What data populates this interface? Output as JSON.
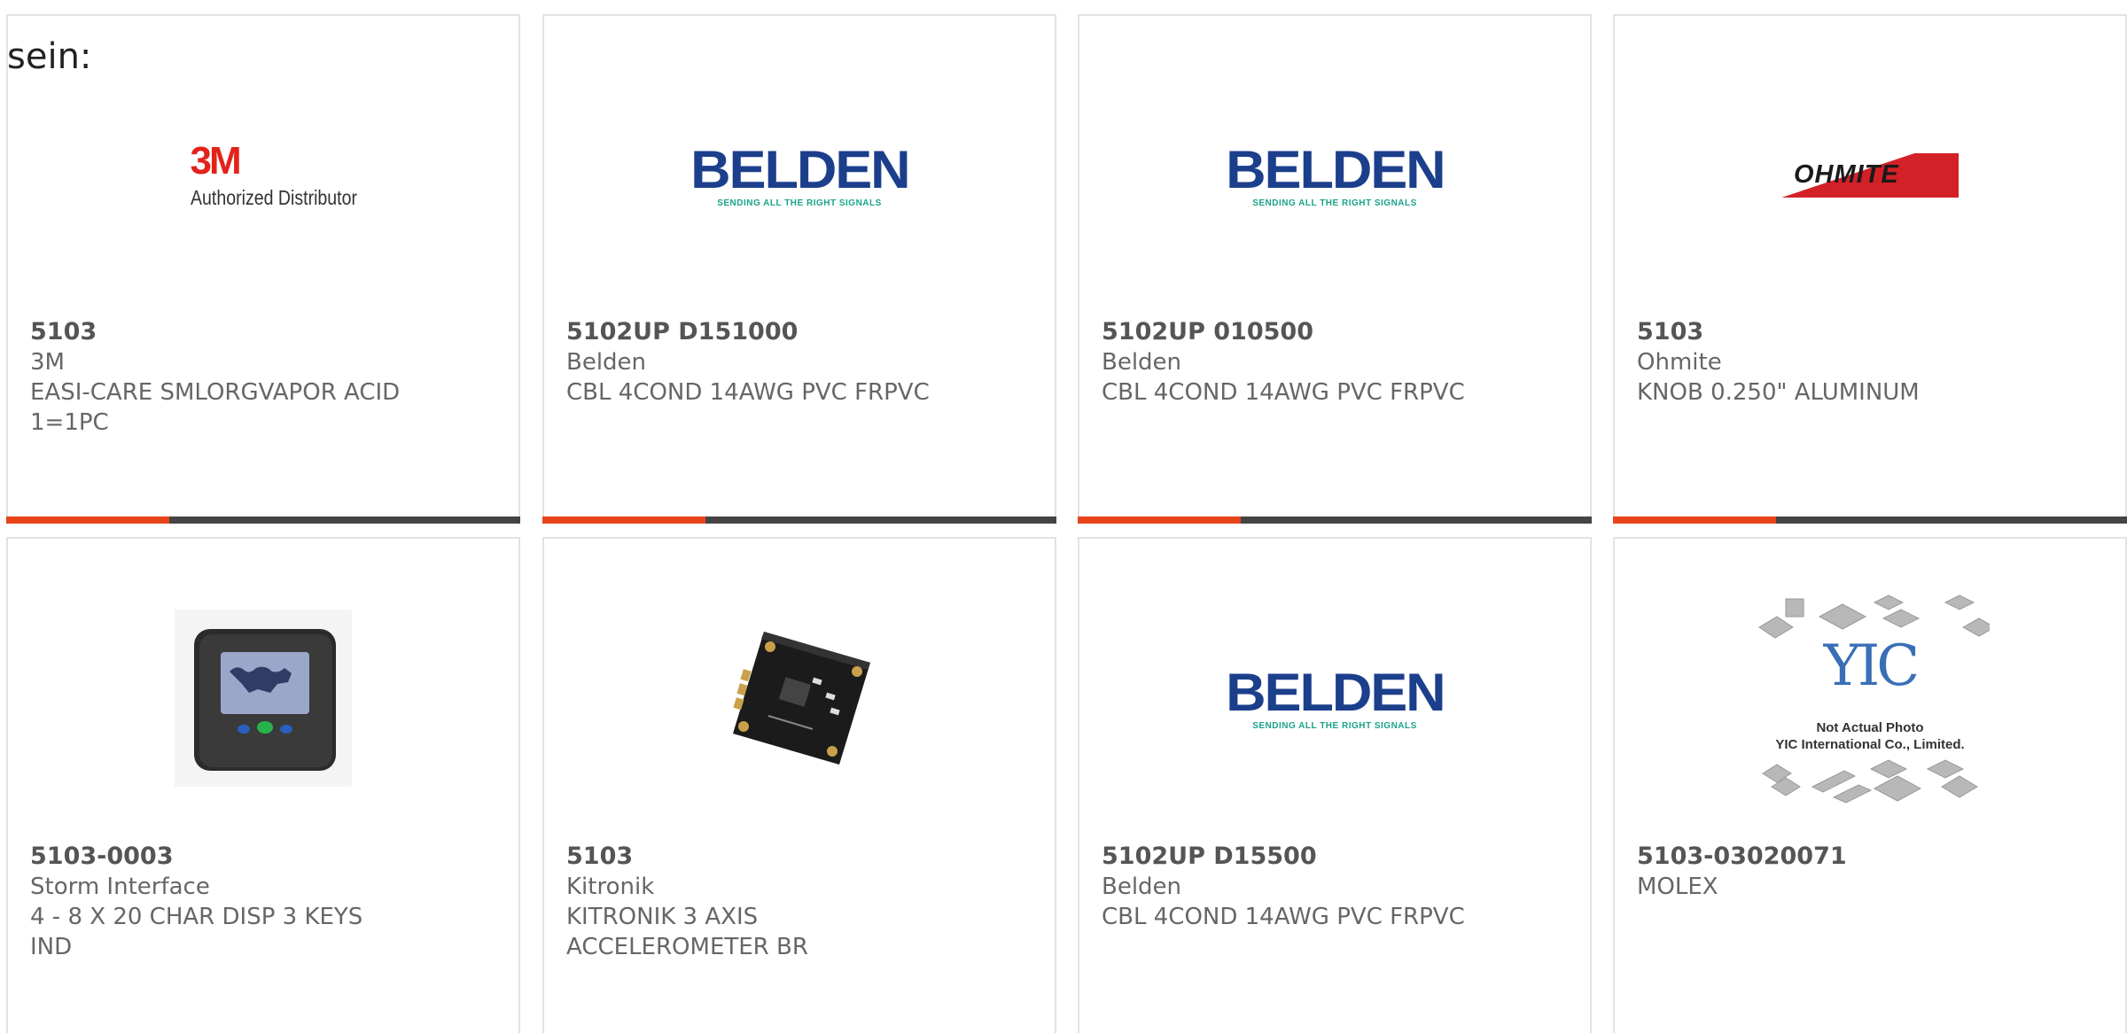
{
  "overflow_text": "sein:",
  "products": [
    {
      "part": "5103",
      "manufacturer": "3M",
      "description": [
        "EASI-CARE SMLORGVAPOR ACID",
        "1=1PC"
      ],
      "logo": {
        "type": "3m",
        "mark": "3M",
        "caption": "Authorized Distributor"
      }
    },
    {
      "part": "5102UP D151000",
      "manufacturer": "Belden",
      "description": [
        "CBL 4COND 14AWG PVC FRPVC"
      ],
      "logo": {
        "type": "belden",
        "mark": "BELDEN",
        "caption": "SENDING ALL THE RIGHT SIGNALS"
      }
    },
    {
      "part": "5102UP 010500",
      "manufacturer": "Belden",
      "description": [
        "CBL 4COND 14AWG PVC FRPVC"
      ],
      "logo": {
        "type": "belden",
        "mark": "BELDEN",
        "caption": "SENDING ALL THE RIGHT SIGNALS"
      }
    },
    {
      "part": "5103",
      "manufacturer": "Ohmite",
      "description": [
        "KNOB 0.250\" ALUMINUM"
      ],
      "logo": {
        "type": "ohmite",
        "mark": "OHMITE"
      }
    },
    {
      "part": "5103-0003",
      "manufacturer": "Storm Interface",
      "description": [
        "4 - 8 X 20 CHAR DISP 3 KEYS",
        "IND"
      ],
      "logo": {
        "type": "display-device-photo"
      }
    },
    {
      "part": "5103",
      "manufacturer": "Kitronik",
      "description": [
        "KITRONIK 3 AXIS",
        "ACCELEROMETER BR"
      ],
      "logo": {
        "type": "pcb-board-photo"
      }
    },
    {
      "part": "5102UP D15500",
      "manufacturer": "Belden",
      "description": [
        "CBL 4COND 14AWG PVC FRPVC"
      ],
      "logo": {
        "type": "belden",
        "mark": "BELDEN",
        "caption": "SENDING ALL THE RIGHT SIGNALS"
      }
    },
    {
      "part": "5103-03020071",
      "manufacturer": "MOLEX",
      "description": [],
      "logo": {
        "type": "yic",
        "mark": "YIC",
        "caption": [
          "Not Actual Photo",
          "YIC International Co., Limited."
        ]
      }
    }
  ],
  "colors": {
    "accent": "#e8441c",
    "bar": "#444444",
    "border": "#e3e3e3",
    "belden_blue": "#1c3f8c",
    "belden_green": "#1aa38a",
    "m3_red": "#e2231a",
    "ohmite_red": "#d42027"
  }
}
